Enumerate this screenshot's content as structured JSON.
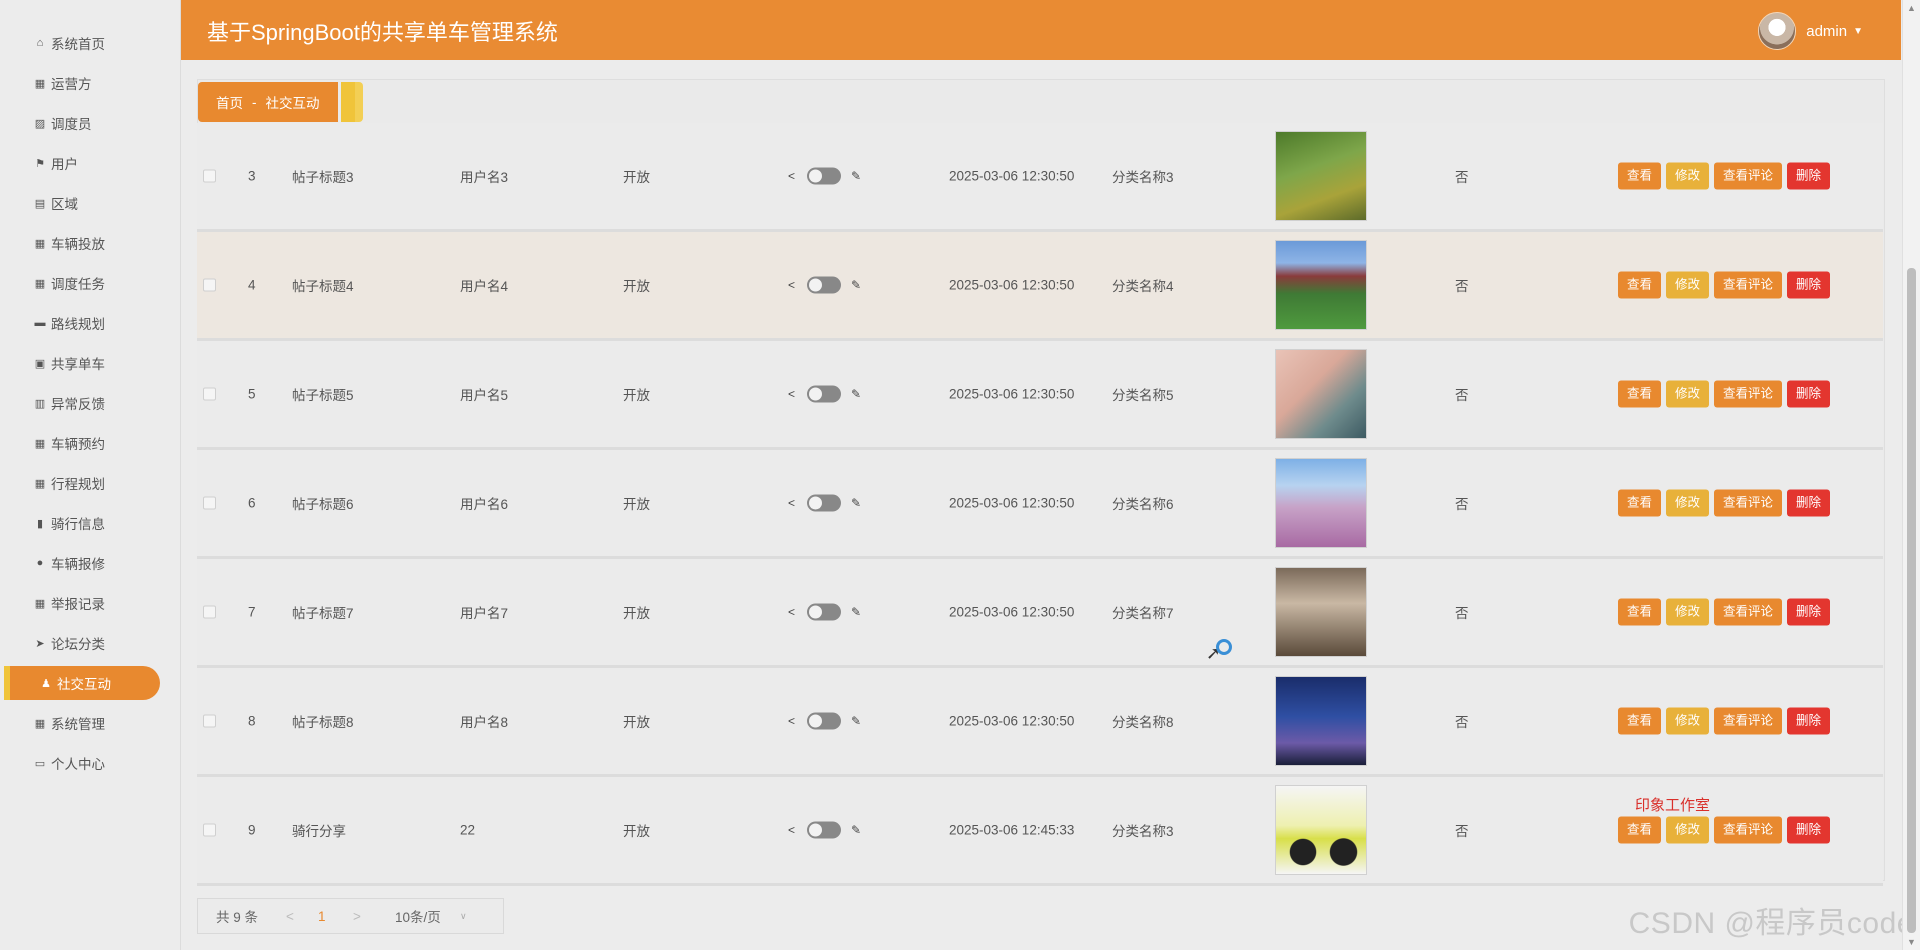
{
  "app": {
    "title": "基于SpringBoot的共享单车管理系统",
    "user": "admin"
  },
  "sidebar": {
    "items": [
      {
        "label": "系统首页",
        "icon": "home-icon"
      },
      {
        "label": "运营方",
        "icon": "grid-icon"
      },
      {
        "label": "调度员",
        "icon": "chart-icon"
      },
      {
        "label": "用户",
        "icon": "flag-icon"
      },
      {
        "label": "区域",
        "icon": "doc-icon"
      },
      {
        "label": "车辆投放",
        "icon": "grid-icon"
      },
      {
        "label": "调度任务",
        "icon": "grid-icon"
      },
      {
        "label": "路线规划",
        "icon": "monitor-icon"
      },
      {
        "label": "共享单车",
        "icon": "briefcase-icon"
      },
      {
        "label": "异常反馈",
        "icon": "clipboard-icon"
      },
      {
        "label": "车辆预约",
        "icon": "grid-icon"
      },
      {
        "label": "行程规划",
        "icon": "grid-icon"
      },
      {
        "label": "骑行信息",
        "icon": "bars-icon"
      },
      {
        "label": "车辆报修",
        "icon": "pin-icon"
      },
      {
        "label": "举报记录",
        "icon": "grid-icon"
      },
      {
        "label": "论坛分类",
        "icon": "send-icon"
      },
      {
        "label": "社交互动",
        "icon": "user-icon",
        "active": true
      },
      {
        "label": "系统管理",
        "icon": "grid-icon"
      },
      {
        "label": "个人中心",
        "icon": "card-icon"
      }
    ]
  },
  "breadcrumb": {
    "home": "首页",
    "sep": "-",
    "current": "社交互动"
  },
  "table": {
    "buttons": {
      "view": "查看",
      "edit": "修改",
      "comments": "查看评论",
      "delete": "删除"
    },
    "rows": [
      {
        "id": "3",
        "title": "帖子标题3",
        "user": "用户名3",
        "status": "开放",
        "time": "2025-03-06 12:30:50",
        "category": "分类名称3",
        "image": "bridge-photo",
        "flag": "否"
      },
      {
        "id": "4",
        "title": "帖子标题4",
        "user": "用户名4",
        "status": "开放",
        "time": "2025-03-06 12:30:50",
        "category": "分类名称4",
        "image": "campus-photo",
        "flag": "否"
      },
      {
        "id": "5",
        "title": "帖子标题5",
        "user": "用户名5",
        "status": "开放",
        "time": "2025-03-06 12:30:50",
        "category": "分类名称5",
        "image": "books-photo",
        "flag": "否"
      },
      {
        "id": "6",
        "title": "帖子标题6",
        "user": "用户名6",
        "status": "开放",
        "time": "2025-03-06 12:30:50",
        "category": "分类名称6",
        "image": "mountain-blossom-photo",
        "flag": "否"
      },
      {
        "id": "7",
        "title": "帖子标题7",
        "user": "用户名7",
        "status": "开放",
        "time": "2025-03-06 12:30:50",
        "category": "分类名称7",
        "image": "people-photo",
        "flag": "否"
      },
      {
        "id": "8",
        "title": "帖子标题8",
        "user": "用户名8",
        "status": "开放",
        "time": "2025-03-06 12:30:50",
        "category": "分类名称8",
        "image": "night-sky-photo",
        "flag": "否"
      },
      {
        "id": "9",
        "title": "骑行分享",
        "user": "22",
        "status": "开放",
        "time": "2025-03-06 12:45:33",
        "category": "分类名称3",
        "image": "ebike-photo",
        "flag": "否"
      }
    ]
  },
  "pager": {
    "total": "共 9 条",
    "prev": "<",
    "page": "1",
    "next": ">",
    "size": "10条/页"
  },
  "overlay": {
    "studio": "印象工作室",
    "csdn": "CSDN @程序员code"
  }
}
